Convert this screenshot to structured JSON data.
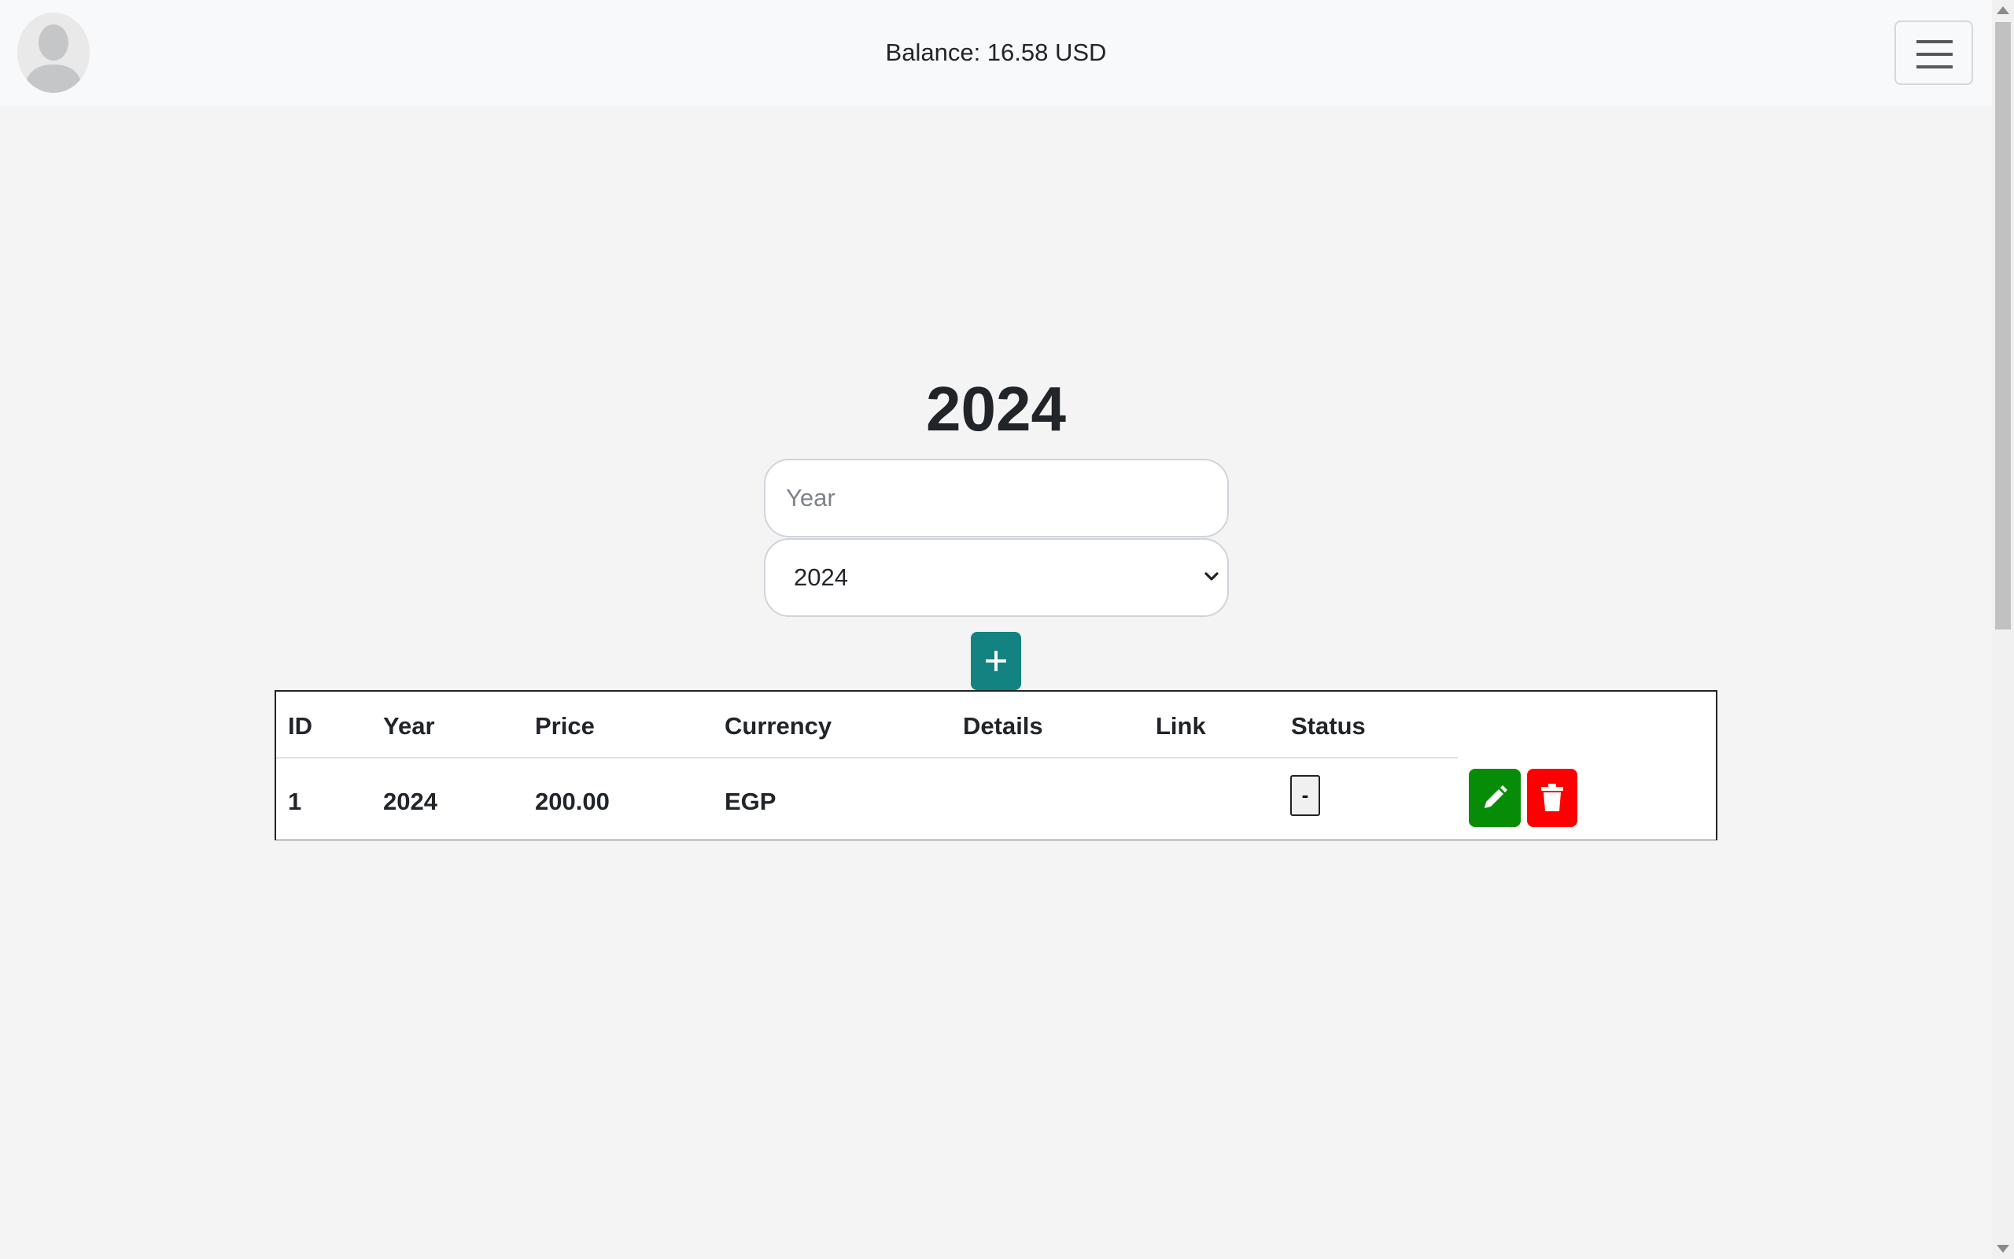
{
  "header": {
    "balance": "Balance: 16.58 USD",
    "avatar_icon": "user-avatar-icon",
    "menu_icon": "hamburger-menu-icon"
  },
  "main": {
    "title": "2024",
    "year_input": {
      "placeholder": "Year",
      "value": ""
    },
    "year_select": {
      "selected": "2024"
    },
    "add_button_icon": "plus-icon"
  },
  "table": {
    "headers": [
      "ID",
      "Year",
      "Price",
      "Currency",
      "Details",
      "Link",
      "Status"
    ],
    "rows": [
      {
        "id": "1",
        "year": "2024",
        "price": "200.00",
        "currency": "EGP",
        "details": "",
        "link": "",
        "status": "-"
      }
    ]
  },
  "colors": {
    "add_button": "#128380",
    "edit_button": "#078c07",
    "delete_button": "#ff0000"
  }
}
